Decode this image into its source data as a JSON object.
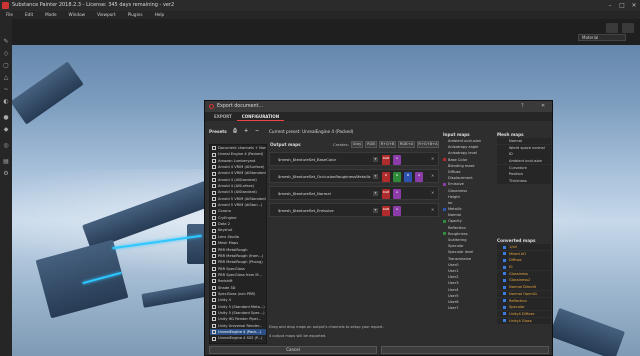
{
  "window": {
    "title": "Substance Painter 2018.2.3 - License: 345 days remaining - ver2",
    "controls": [
      "–",
      "□",
      "✕"
    ]
  },
  "menu": [
    "File",
    "Edit",
    "Mode",
    "Window",
    "Viewport",
    "Plugins",
    "Help"
  ],
  "viewport": {
    "material_dropdown": "Material"
  },
  "dialog": {
    "title": "Export document...",
    "help": "?",
    "close": "✕",
    "tabs": [
      "EXPORT",
      "CONFIGURATION"
    ],
    "active_tab": "CONFIGURATION",
    "presets_label": "Presets",
    "presets": [
      "Document channels + Normal + AO (No Alpha)",
      "Unreal Engine 4 (Packed)",
      "Amazon Lumberyard",
      "Arnold 4 VRIM (AlSurface)",
      "Arnold 4 VRIM (AlStandard)",
      "Arnold 4 (AlStandard)",
      "Arnold 4 (AlSurface)",
      "Arnold 5 (AiStandard)",
      "Arnold 5 VRIM (AiStandard)",
      "Arnold 5 VRIM (AiStan...)",
      "Corona",
      "CryEngine",
      "Dota 2",
      "Keyshot",
      "Lens Studio",
      "Mesh Maps",
      "PBR MetalRough",
      "PBR MetalRough (from...)",
      "PBR MetalRough (Phong)",
      "PBR SpecGloss",
      "PBR SpecGloss from M...",
      "Redshift",
      "Shade 3D",
      "SpecGloss (non PBR)",
      "Unity 4",
      "Unity 5 (Standard Meta...)",
      "Unity 5 (Standard Spec...)",
      "Unity HD Render Pipel...",
      "Unity Universal Render...",
      "UnrealEngine 4 (Pack...)",
      "UnrealEngine 4 SSS (P...)",
      "Vray",
      "Vray-UDIM"
    ],
    "selected_preset": 29,
    "current_preset": "Current preset: UnrealEngine 4 (Packed)",
    "output_maps_label": "Output maps",
    "creates_label": "Creates:",
    "channel_buttons": [
      "Gray",
      "RGB",
      "R+G+B",
      "RGB+A",
      "R+G+B+A"
    ],
    "output_maps": [
      {
        "name": "$mesh_$textureSet_BaseColor",
        "swatches": [
          {
            "label": "RGB",
            "color": "#b02c2c"
          },
          {
            "label": "A",
            "color": "#8c3ca8"
          }
        ]
      },
      {
        "name": "$mesh_$textureSet_OcclusionRoughnessMetallic",
        "swatches": [
          {
            "label": "R",
            "color": "#b02c2c"
          },
          {
            "label": "G",
            "color": "#2f8a3a"
          },
          {
            "label": "B",
            "color": "#2d52b0"
          },
          {
            "label": "A",
            "color": "#8c3ca8"
          }
        ]
      },
      {
        "name": "$mesh_$textureSet_Normal",
        "swatches": [
          {
            "label": "RGB",
            "color": "#b02c2c"
          },
          {
            "label": "A",
            "color": "#8c3ca8"
          }
        ]
      },
      {
        "name": "$mesh_$textureSet_Emissive",
        "swatches": [
          {
            "label": "RGB",
            "color": "#b02c2c"
          },
          {
            "label": "A",
            "color": "#8c3ca8"
          }
        ]
      }
    ],
    "hint": "Drag and drop maps on output's channels to setup your export.",
    "export_count": "4 output maps will be exported.",
    "cancel_label": "Cancel",
    "input_maps_label": "Input maps",
    "input_maps": [
      {
        "label": "Ambient occlusion",
        "color": ""
      },
      {
        "label": "Anisotropy angle",
        "color": ""
      },
      {
        "label": "Anisotropy level",
        "color": ""
      },
      {
        "label": "Base Color",
        "color": "#b02c2c"
      },
      {
        "label": "Blending mask",
        "color": ""
      },
      {
        "label": "Diffuse",
        "color": ""
      },
      {
        "label": "Displacement",
        "color": ""
      },
      {
        "label": "Emissive",
        "color": "#8c3ca8"
      },
      {
        "label": "Glossiness",
        "color": ""
      },
      {
        "label": "Height",
        "color": ""
      },
      {
        "label": "Ior",
        "color": ""
      },
      {
        "label": "Metallic",
        "color": "#2d52b0"
      },
      {
        "label": "Normal",
        "color": ""
      },
      {
        "label": "Opacity",
        "color": "#2f8a3a"
      },
      {
        "label": "Reflection",
        "color": ""
      },
      {
        "label": "Roughness",
        "color": "#2f8a3a"
      },
      {
        "label": "Scattering",
        "color": ""
      },
      {
        "label": "Specular",
        "color": ""
      },
      {
        "label": "Specular level",
        "color": ""
      },
      {
        "label": "Transmissive",
        "color": ""
      },
      {
        "label": "User0",
        "color": ""
      },
      {
        "label": "User1",
        "color": ""
      },
      {
        "label": "User2",
        "color": ""
      },
      {
        "label": "User3",
        "color": ""
      },
      {
        "label": "User4",
        "color": ""
      },
      {
        "label": "User5",
        "color": ""
      },
      {
        "label": "User6",
        "color": ""
      },
      {
        "label": "User7",
        "color": ""
      }
    ],
    "mesh_maps_label": "Mesh maps",
    "mesh_maps": [
      "Normal",
      "World space normal",
      "ID",
      "Ambient occlusion",
      "Curvature",
      "Position",
      "Thickness"
    ],
    "converted_maps_label": "Converted maps",
    "converted_maps": [
      "1/all",
      "Mixed AO",
      "Diffuse",
      "f0",
      "Glossiness",
      "Glossiness2",
      "Normal DirectX",
      "Normal OpenGL",
      "Reflection",
      "Specular",
      "Unity4 Diffuse",
      "Unity4 Gloss"
    ]
  }
}
